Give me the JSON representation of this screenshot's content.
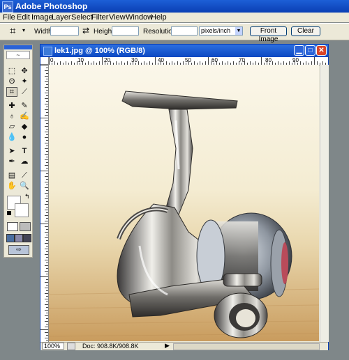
{
  "app": {
    "title": "Adobe Photoshop",
    "icon": "Ps"
  },
  "menu": [
    "File",
    "Edit",
    "Image",
    "Layer",
    "Select",
    "Filter",
    "View",
    "Window",
    "Help"
  ],
  "options": {
    "crop_glyph": "⌗",
    "width_label": "Width:",
    "width_value": "",
    "swap_glyph": "⇄",
    "height_label": "Height:",
    "height_value": "",
    "resolution_label": "Resolution:",
    "resolution_value": "",
    "units_value": "pixels/inch",
    "front_image_label": "Front Image",
    "clear_label": "Clear"
  },
  "document": {
    "title": "lek1.jpg @ 100% (RGB/8)",
    "zoom": "100%",
    "doc_info": "Doc: 908.8K/908.8K",
    "ruler_ticks": [
      "0",
      "10",
      "20",
      "30",
      "40",
      "50",
      "60",
      "70",
      "80",
      "90"
    ]
  },
  "colors": {
    "titlebar": "#0a3fb4",
    "chrome": "#ece9d8",
    "workspace": "#7f8789",
    "close": "#d9452a"
  }
}
